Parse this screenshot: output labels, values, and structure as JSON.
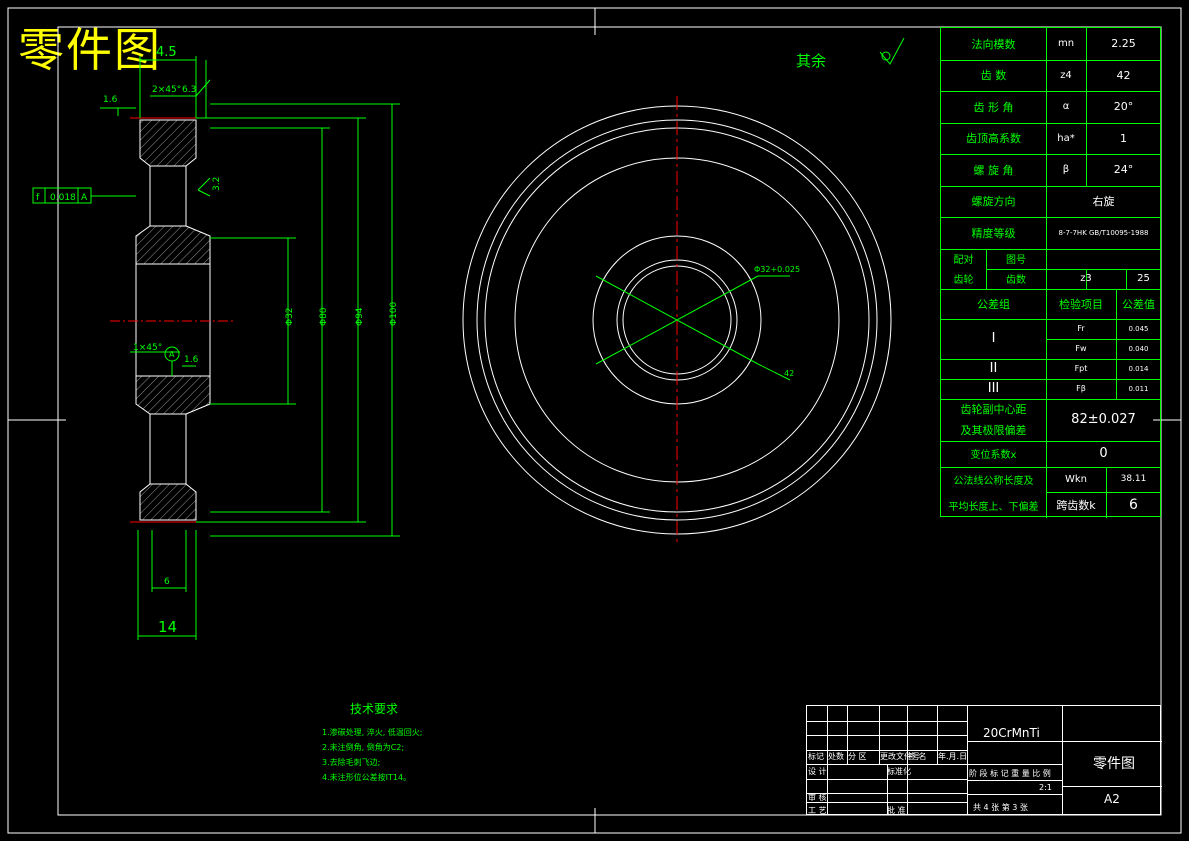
{
  "drawing_title": "零件图",
  "surface_note": "其余",
  "section_dims": {
    "top_width": "4.5",
    "flatness": "1.6",
    "chamfer_top": "2×45°",
    "ra_top": "6.3",
    "tolerance_symbol": "f",
    "tolerance_value": "0.018",
    "tolerance_ref": "A",
    "ra_side": "3.2",
    "chamfer_bottom": "1×45°",
    "datum": "A",
    "ra_bottom": "1.6",
    "dia_1": "Φ32",
    "dia_2": "Φ80",
    "dia_3": "Φ94",
    "dia_4": "Φ100",
    "web_width": "6",
    "overall_width": "14"
  },
  "front_view": {
    "bore_label": "Φ32+0.025",
    "diag_label": "42"
  },
  "gear_table": {
    "rows": [
      {
        "label": "法向模数",
        "symbol": "mn",
        "value": "2.25"
      },
      {
        "label": "齿  数",
        "symbol": "z4",
        "value": "42"
      },
      {
        "label": "齿 形 角",
        "symbol": "α",
        "value": "20°"
      },
      {
        "label": "齿顶高系数",
        "symbol": "ha*",
        "value": "1"
      },
      {
        "label": "螺 旋 角",
        "symbol": "β",
        "value": "24°"
      },
      {
        "label": "螺旋方向",
        "value": "右旋"
      },
      {
        "label": "精度等级",
        "value": "8-7-7HK GB/T10095-1988"
      }
    ],
    "pair": {
      "label_top": "配对",
      "label_bottom": "齿轮",
      "h1": "图号",
      "h2": "齿数",
      "sym": "z3",
      "val": "25"
    },
    "groups_header": [
      "公差组",
      "检验项目",
      "公差值"
    ],
    "groups": [
      {
        "name": "I",
        "items": [
          {
            "code": "Fr",
            "val": "0.045"
          },
          {
            "code": "Fw",
            "val": "0.040"
          }
        ]
      },
      {
        "name": "II",
        "items": [
          {
            "code": "Fpt",
            "val": "0.014"
          }
        ]
      },
      {
        "name": "III",
        "items": [
          {
            "code": "Fβ",
            "val": "0.011"
          }
        ]
      }
    ],
    "center_distance": {
      "label1": "齿轮副中心距",
      "label2": "及其极限偏差",
      "value": "82±0.027"
    },
    "shift": {
      "label": "变位系数x",
      "value": "0"
    },
    "span": {
      "label1": "公法线公称长度及",
      "label2": "平均长度上、下偏差",
      "w_label": "Wkn",
      "w_value": "38.11",
      "k_label": "跨齿数k",
      "k_value": "6"
    }
  },
  "requirements": {
    "title": "技术要求",
    "items": [
      "1.渗碳处理, 淬火, 低温回火;",
      "2.未注倒角, 倒角为C2;",
      "3.去除毛刺飞边;",
      "4.未注形位公差按IT14。"
    ]
  },
  "title_block": {
    "material": "20CrMnTi",
    "name": "零件图",
    "sheet": "A2",
    "scale": "2:1",
    "count": "共 4 张  第 3 张",
    "header": [
      "标记",
      "处数",
      "分 区",
      "更改文件号",
      "签 名",
      "年.月.日"
    ],
    "rows": [
      "设 计",
      "标准化",
      "审 核",
      "工 艺",
      "批 准"
    ],
    "stage_header": [
      "阶 段 标 记",
      "重 量",
      "比 例"
    ]
  },
  "colors": {
    "line": "#ffffff",
    "dim": "#00ff00",
    "center": "#ff0000",
    "title": "#ffff00"
  }
}
